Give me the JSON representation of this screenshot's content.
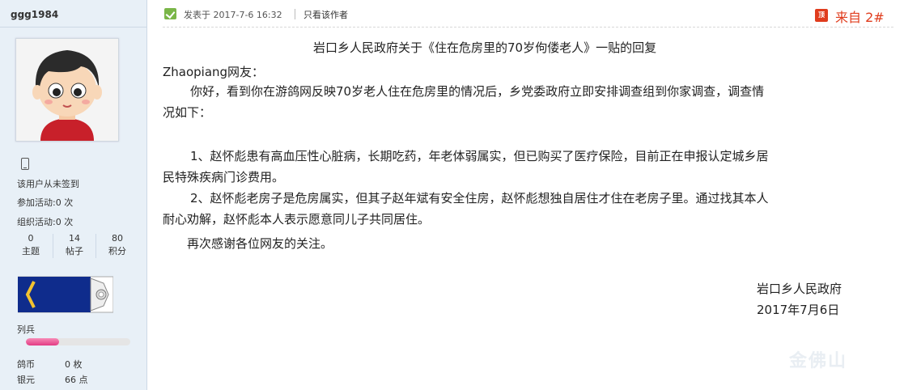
{
  "user": {
    "username": "ggg1984",
    "checkin": "该用户从未签到",
    "join_activity": "参加活动:0 次",
    "organize_activity": "组织活动:0 次",
    "counts": [
      {
        "num": "0",
        "label": "主题"
      },
      {
        "num": "14",
        "label": "帖子"
      },
      {
        "num": "80",
        "label": "积分"
      }
    ],
    "rank": "列兵",
    "rank_progress_percent": 0.32,
    "coins_label": "鸽币",
    "coins_value": "0 枚",
    "silver_label": "银元",
    "silver_value": "66 点"
  },
  "post": {
    "posted_at": "发表于 2017-7-6 16:32",
    "only_author": "只看该作者",
    "floor_icon": "顶",
    "floor_label": "来自 2#",
    "title": "岩口乡人民政府关于《住在危房里的70岁佝偻老人》一贴的回复",
    "greeting": "Zhaopiang网友：",
    "p1a": "你好，看到你在游鸽网反映70岁老人住在危房里的情况后，乡党委政府立即安排调查组到你家调查，调查情",
    "p1b": "况如下：",
    "p2a": "1、赵怀彪患有高血压性心脏病，长期吃药，年老体弱属实，但已购买了医疗保险，目前正在申报认定城乡居",
    "p2b": "民特殊疾病门诊费用。",
    "p3a": "2、赵怀彪老房子是危房属实，但其子赵年斌有安全住房，赵怀彪想独自居住才住在老房子里。通过找其本人",
    "p3b": "耐心劝解，赵怀彪本人表示愿意同儿子共同居住。",
    "p4": "再次感谢各位网友的关注。",
    "sign_org": "岩口乡人民政府",
    "sign_date": "2017年7月6日"
  },
  "watermark": "金佛山"
}
